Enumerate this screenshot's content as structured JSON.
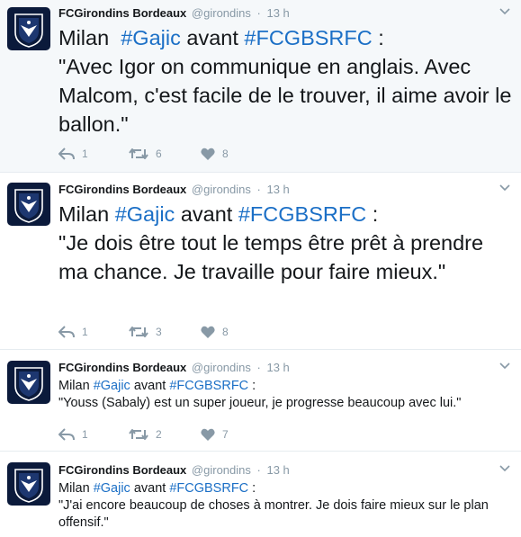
{
  "tweets": [
    {
      "name": "FCGirondins Bordeaux",
      "handle": "@girondins",
      "separator": "·",
      "time": "13 h",
      "text_start": "Milan  ",
      "hashtag1": "#Gajic",
      "text_mid": " avant ",
      "hashtag2": "#FCGBSRFC",
      "text_after": " :",
      "quote": "\"Avec Igor on communique en anglais. Avec Malcom, c'est facile de le trouver, il aime avoir le ballon.\"",
      "replies": "1",
      "retweets": "6",
      "likes": "8"
    },
    {
      "name": "FCGirondins Bordeaux",
      "handle": "@girondins",
      "separator": "·",
      "time": "13 h",
      "text_start": "Milan ",
      "hashtag1": "#Gajic",
      "text_mid": " avant ",
      "hashtag2": "#FCGBSRFC",
      "text_after": " :",
      "quote": "\"Je dois être tout le temps être prêt à prendre ma chance. Je travaille pour faire mieux.\"",
      "replies": "1",
      "retweets": "3",
      "likes": "8"
    },
    {
      "name": "FCGirondins Bordeaux",
      "handle": "@girondins",
      "separator": "·",
      "time": "13 h",
      "text_start": "Milan ",
      "hashtag1": "#Gajic",
      "text_mid": " avant ",
      "hashtag2": "#FCGBSRFC",
      "text_after": " :",
      "quote": "\"Youss (Sabaly) est un super joueur, je progresse beaucoup avec lui.\"",
      "replies": "1",
      "retweets": "2",
      "likes": "7"
    },
    {
      "name": "FCGirondins Bordeaux",
      "handle": "@girondins",
      "separator": "·",
      "time": "13 h",
      "text_start": "Milan ",
      "hashtag1": "#Gajic",
      "text_mid": " avant ",
      "hashtag2": "#FCGBSRFC",
      "text_after": " :",
      "quote": "\"J'ai encore beaucoup de choses à montrer. Je dois faire mieux sur le plan offensif.\""
    }
  ],
  "colors": {
    "hashtag": "#1b6fc6",
    "meta": "#8899a6",
    "avatar_bg": "#0b1a3b",
    "highlight_bg": "#f5f8fa"
  },
  "icons": [
    "girondins-logo",
    "chevron-down-icon",
    "reply-icon",
    "retweet-icon",
    "heart-icon"
  ]
}
